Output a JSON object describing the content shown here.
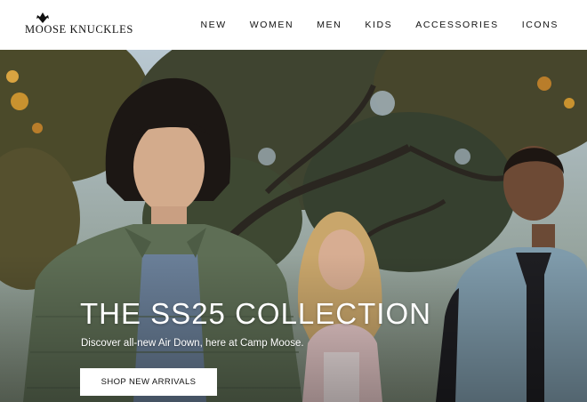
{
  "brand": {
    "name": "MOOSE KNUCKLES",
    "logo_icon": "moose-antler-icon"
  },
  "nav": {
    "items": [
      {
        "label": "NEW"
      },
      {
        "label": "WOMEN"
      },
      {
        "label": "MEN"
      },
      {
        "label": "KIDS"
      },
      {
        "label": "ACCESSORIES"
      },
      {
        "label": "ICONS"
      }
    ]
  },
  "hero": {
    "title": "THE SS25 COLLECTION",
    "subtitle": "Discover all-new Air Down, here at Camp Moose.",
    "cta_label": "SHOP NEW ARRIVALS"
  },
  "colors": {
    "header_bg": "#ffffff",
    "text_dark": "#111111",
    "hero_text": "#ffffff",
    "jacket_green": "#5e6e55",
    "vest_blue": "#7f9bab",
    "jacket_pink": "#e7c9c9"
  }
}
